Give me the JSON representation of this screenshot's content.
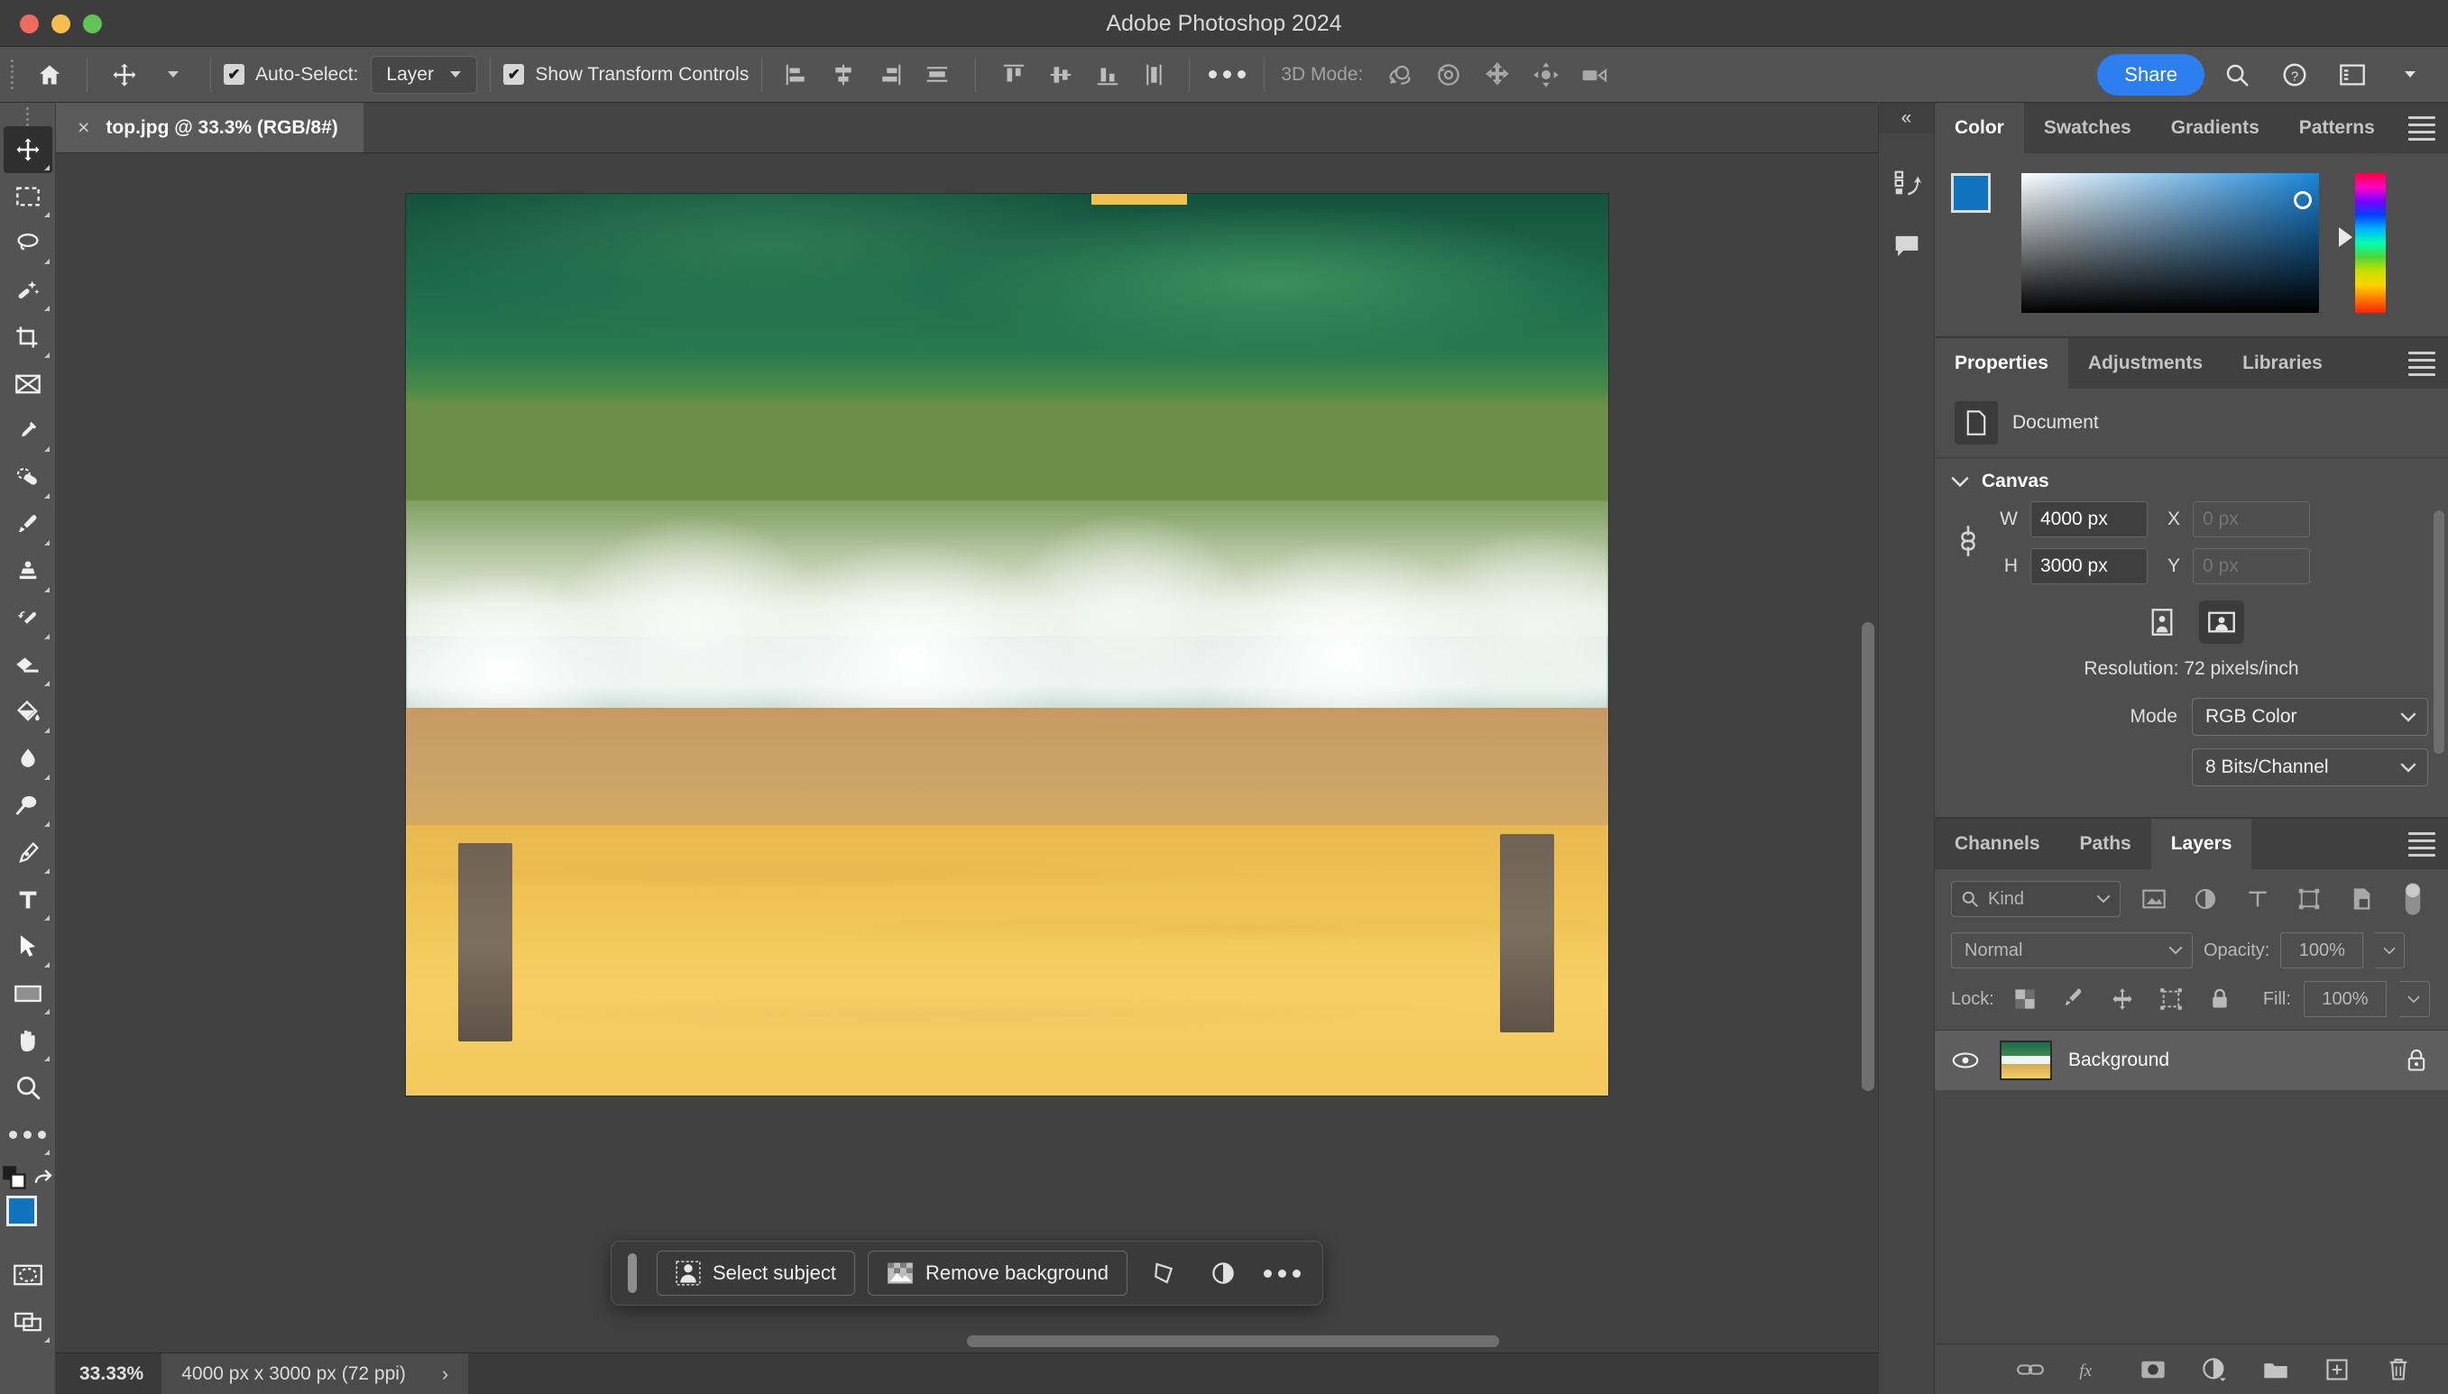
{
  "window": {
    "title": "Adobe Photoshop 2024"
  },
  "options_bar": {
    "home_icon": "home-icon",
    "active_tool_icon": "move-tool-icon",
    "auto_select": {
      "checked": true,
      "label": "Auto-Select:",
      "value": "Layer"
    },
    "show_transform": {
      "checked": true,
      "label": "Show Transform Controls"
    },
    "align_buttons": [
      "align-left-edges",
      "align-horizontal-centers",
      "align-right-edges",
      "distribute-horizontally",
      "align-top-edges",
      "align-vertical-centers",
      "align-bottom-edges",
      "distribute-vertically"
    ],
    "more_label": "•••",
    "mode_3d_label": "3D Mode:",
    "mode_3d_buttons": [
      "orbit-3d-icon",
      "roll-3d-icon",
      "pan-3d-icon",
      "slide-3d-icon",
      "camera-3d-icon"
    ],
    "share_label": "Share",
    "right_icons": [
      "search-icon",
      "help-icon",
      "workspace-icon",
      "chevron-down-icon"
    ]
  },
  "document_tab": {
    "label": "top.jpg @ 33.3% (RGB/8#)",
    "close": "×"
  },
  "toolbar": {
    "tools": [
      {
        "name": "move-tool",
        "active": true
      },
      {
        "name": "rectangular-marquee-tool",
        "active": false
      },
      {
        "name": "lasso-tool",
        "active": false
      },
      {
        "name": "object-selection-tool",
        "active": false
      },
      {
        "name": "crop-tool",
        "active": false
      },
      {
        "name": "frame-tool",
        "active": false
      },
      {
        "name": "eyedropper-tool",
        "active": false
      },
      {
        "name": "spot-healing-brush-tool",
        "active": false
      },
      {
        "name": "brush-tool",
        "active": false
      },
      {
        "name": "clone-stamp-tool",
        "active": false
      },
      {
        "name": "history-brush-tool",
        "active": false
      },
      {
        "name": "eraser-tool",
        "active": false
      },
      {
        "name": "gradient-tool",
        "active": false
      },
      {
        "name": "blur-tool",
        "active": false
      },
      {
        "name": "dodge-tool",
        "active": false
      },
      {
        "name": "pen-tool",
        "active": false
      },
      {
        "name": "type-tool",
        "active": false
      },
      {
        "name": "path-selection-tool",
        "active": false
      },
      {
        "name": "rectangle-tool",
        "active": false
      },
      {
        "name": "hand-tool",
        "active": false
      },
      {
        "name": "zoom-tool",
        "active": false
      },
      {
        "name": "edit-toolbar-tool",
        "active": false
      }
    ],
    "foreground_color": "#1073bd",
    "background_color": "#ffffff"
  },
  "contextual_task_bar": {
    "select_subject_label": "Select subject",
    "remove_background_label": "Remove background",
    "extra_icons": [
      "transform-icon",
      "adjustment-icon",
      "more-options-icon"
    ]
  },
  "status_bar": {
    "zoom": "33.33%",
    "doc_info": "4000 px x 3000 px (72 ppi)",
    "chevron": "›"
  },
  "right_strip": {
    "collapse_label": "«",
    "icons": [
      "history-panel-icon",
      "comments-panel-icon"
    ]
  },
  "color_panel": {
    "tabs": [
      {
        "label": "Color",
        "active": true
      },
      {
        "label": "Swatches",
        "active": false
      },
      {
        "label": "Gradients",
        "active": false
      },
      {
        "label": "Patterns",
        "active": false
      }
    ],
    "foreground_color": "#1073bd",
    "background_color": "#ffffff"
  },
  "properties_panel": {
    "tabs": [
      {
        "label": "Properties",
        "active": true
      },
      {
        "label": "Adjustments",
        "active": false
      },
      {
        "label": "Libraries",
        "active": false
      }
    ],
    "document_label": "Document",
    "canvas_section": "Canvas",
    "fields": {
      "w_label": "W",
      "w_value": "4000 px",
      "h_label": "H",
      "h_value": "3000 px",
      "x_label": "X",
      "x_placeholder": "0 px",
      "y_label": "Y",
      "y_placeholder": "0 px"
    },
    "orientation": {
      "portrait": "portrait-icon",
      "landscape": "landscape-icon",
      "selected": "landscape"
    },
    "resolution": "Resolution: 72 pixels/inch",
    "mode_label": "Mode",
    "mode_value": "RGB Color",
    "depth_value": "8 Bits/Channel"
  },
  "layers_panel": {
    "tabs": [
      {
        "label": "Channels",
        "active": false
      },
      {
        "label": "Paths",
        "active": false
      },
      {
        "label": "Layers",
        "active": true
      }
    ],
    "filter": {
      "kind_label": "Kind",
      "filter_icons": [
        "pixel-filter-icon",
        "adjustment-filter-icon",
        "type-filter-icon",
        "shape-filter-icon",
        "smart-object-filter-icon"
      ],
      "toggle": "filter-toggle"
    },
    "blend_mode": "Normal",
    "opacity_label": "Opacity:",
    "opacity_value": "100%",
    "lock_label": "Lock:",
    "lock_icons": [
      "lock-transparent-pixels-icon",
      "lock-image-pixels-icon",
      "lock-position-icon",
      "lock-artboard-nesting-icon",
      "lock-all-icon"
    ],
    "fill_label": "Fill:",
    "fill_value": "100%",
    "layers": [
      {
        "name": "Background",
        "visible": true,
        "locked": true
      }
    ],
    "footer_icons": [
      "link-layers-icon",
      "layer-style-fx-icon",
      "add-layer-mask-icon",
      "new-adjustment-layer-icon",
      "new-group-icon",
      "new-layer-icon",
      "delete-layer-icon"
    ]
  }
}
